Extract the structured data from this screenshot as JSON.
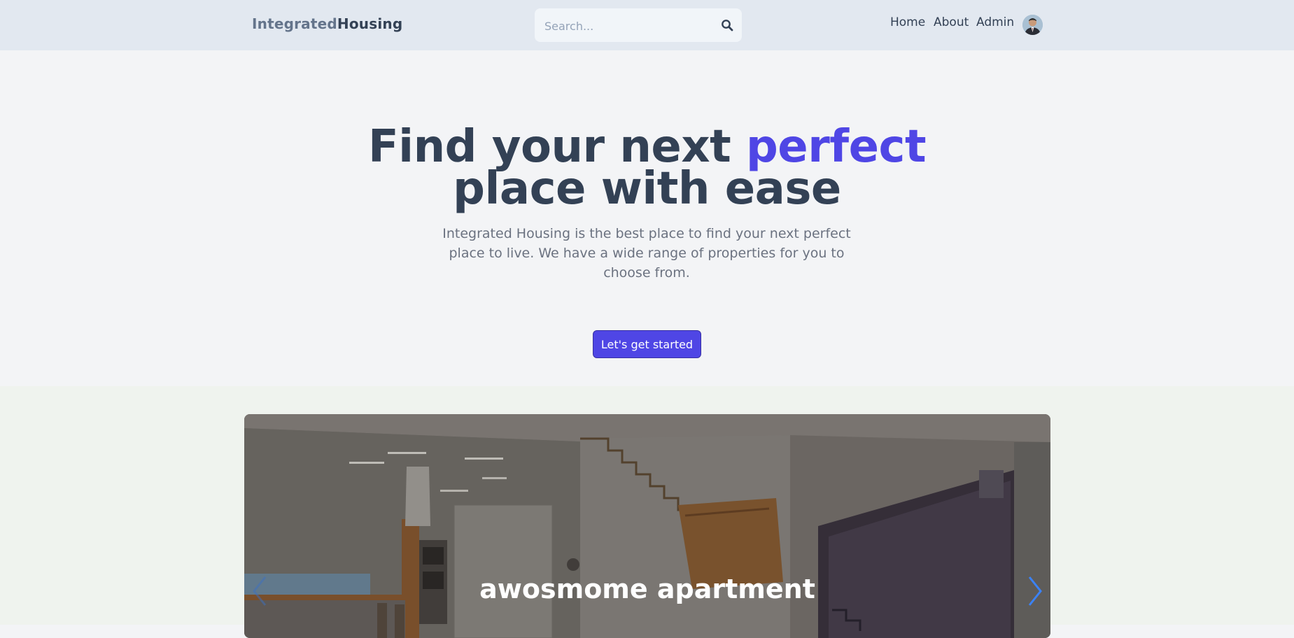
{
  "header": {
    "logo_part1": "Integrated",
    "logo_part2": "Housing",
    "search": {
      "placeholder": "Search..."
    },
    "nav": [
      "Home",
      "About",
      "Admin"
    ]
  },
  "hero": {
    "title_line1_a": "Find your next ",
    "title_line1_highlight": "perfect",
    "title_line2": "place with ease",
    "description": "Integrated Housing is the best place to find your next perfect place to live. We have a wide range of properties for you to choose from.",
    "cta_label": "Let's get started"
  },
  "carousel": {
    "slide_title": "awosmome apartment"
  },
  "colors": {
    "accent": "#4f46e5",
    "header_bg": "#e2e8f0",
    "text_dark": "#334155"
  }
}
